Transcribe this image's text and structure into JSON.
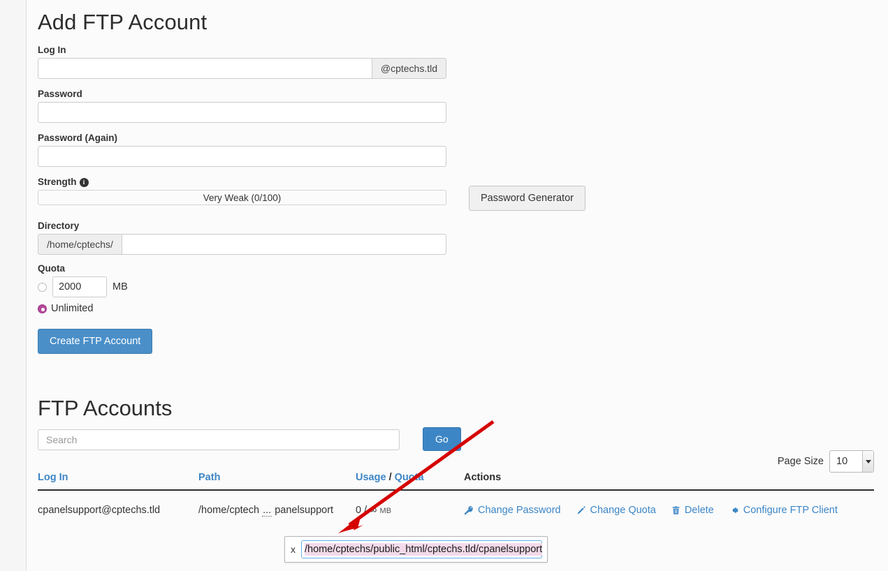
{
  "form": {
    "title": "Add FTP Account",
    "login_label": "Log In",
    "login_value": "",
    "login_domain_addon": "@cptechs.tld",
    "password_label": "Password",
    "password_value": "",
    "password_again_label": "Password (Again)",
    "password_again_value": "",
    "strength_label": "Strength",
    "strength_info_icon": "info-icon",
    "strength_value": "Very Weak (0/100)",
    "password_generator_label": "Password Generator",
    "directory_label": "Directory",
    "directory_prefix": "/home/cptechs/",
    "directory_value": "",
    "quota_label": "Quota",
    "quota_value": "2000",
    "quota_unit": "MB",
    "quota_unlimited_label": "Unlimited",
    "quota_selected": "Unlimited",
    "submit_label": "Create FTP Account"
  },
  "list": {
    "title": "FTP Accounts",
    "search_placeholder": "Search",
    "search_value": "",
    "go_label": "Go",
    "page_size_label": "Page Size",
    "page_size_value": "10",
    "columns": {
      "login": "Log In",
      "path": "Path",
      "usage": "Usage",
      "separator": "/",
      "quota": "Quota",
      "actions": "Actions"
    },
    "rows": [
      {
        "login": "cpanelsupport@cptechs.tld",
        "path_prefix": "/home/cptech",
        "path_ellipsis": "...",
        "path_suffix": "panelsupport",
        "usage_used": "0",
        "usage_separator": "/",
        "usage_quota": "∞",
        "usage_unit": "MB",
        "actions": [
          {
            "label": "Change Password",
            "icon": "key-icon"
          },
          {
            "label": "Change Quota",
            "icon": "pencil-icon"
          },
          {
            "label": "Delete",
            "icon": "trash-icon"
          },
          {
            "label": "Configure FTP Client",
            "icon": "gear-icon"
          }
        ]
      }
    ]
  },
  "edit_popup": {
    "close_label": "x",
    "path_value": "/home/cptechs/public_html/cptechs.tld/cpanelsupport"
  },
  "annotation": {
    "arrow_color": "#d50000"
  },
  "colors": {
    "primary_blue": "#3d86c6",
    "link_blue": "#3d86c6",
    "radio_selected": "#b5479b",
    "selection_pink": "#f3daea",
    "focus_border": "#66afe9"
  }
}
